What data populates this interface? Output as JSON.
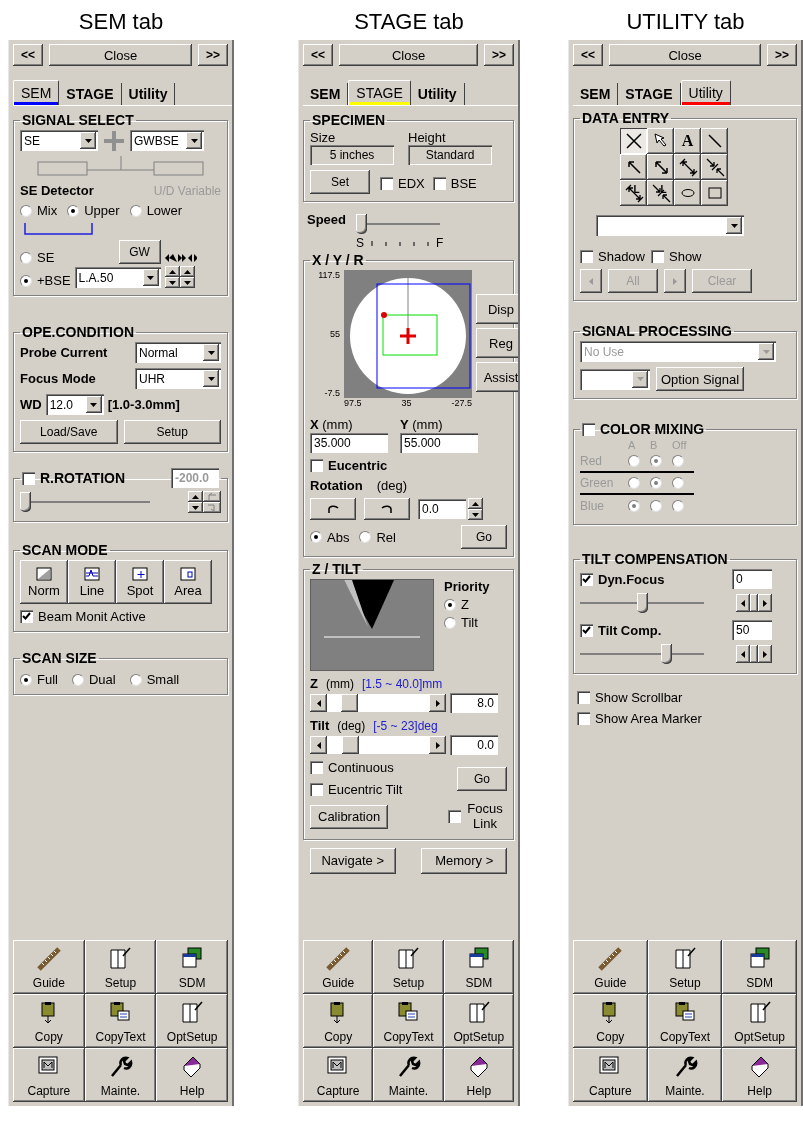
{
  "panels": [
    {
      "caption": "SEM tab",
      "color": "#0000ff",
      "nav": {
        "prev": "<<",
        "close": "Close",
        "next": ">>"
      },
      "tabs": [
        {
          "label": "SEM",
          "selected": true
        },
        {
          "label": "STAGE",
          "selected": false
        },
        {
          "label": "Utility",
          "selected": false
        }
      ],
      "sections": [
        {
          "kind": "signal_select",
          "title": "SIGNAL SELECT",
          "left": "SE",
          "right": "GWBSE",
          "detector": "SE Detector",
          "variable": {
            "label": "U/D Variable",
            "disabled": true
          },
          "detector_modes": [
            {
              "label": "Mix",
              "selected": false
            },
            {
              "label": "Upper",
              "selected": true
            },
            {
              "label": "Lower",
              "selected": false
            }
          ],
          "signals": [
            {
              "label": "SE",
              "selected": false
            },
            {
              "label": "+BSE",
              "selected": true
            }
          ],
          "gw": "GW",
          "mode": "L.A.50"
        },
        {
          "kind": "ope_condition",
          "title": "OPE.CONDITION",
          "rows": [
            {
              "label": "Probe Current",
              "value": "Normal"
            },
            {
              "label": "Focus Mode",
              "value": "UHR"
            }
          ],
          "wd": {
            "label": "WD",
            "value": "12.0",
            "range": "[1.0-3.0mm]"
          },
          "buttons": [
            "Load/Save",
            "Setup"
          ]
        },
        {
          "kind": "rotation",
          "title": "R.ROTATION",
          "checked": false,
          "value": "-200.0",
          "level": 0
        },
        {
          "kind": "scan_mode",
          "title": "SCAN MODE",
          "modes": [
            {
              "kind": "norm",
              "label": "Norm"
            },
            {
              "kind": "line",
              "label": "Line"
            },
            {
              "kind": "spot",
              "label": "Spot"
            },
            {
              "kind": "area",
              "label": "Area"
            }
          ],
          "beam": {
            "label": "Beam Monit Active",
            "checked": true
          }
        },
        {
          "kind": "scan_size",
          "title": "SCAN SIZE",
          "options": [
            {
              "label": "Full",
              "selected": true
            },
            {
              "label": "Dual",
              "selected": false
            },
            {
              "label": "Small",
              "selected": false
            }
          ]
        }
      ],
      "toolbar": [
        {
          "kind": "guide",
          "label": "Guide"
        },
        {
          "kind": "setup",
          "label": "Setup"
        },
        {
          "kind": "sdm",
          "label": "SDM"
        },
        {
          "kind": "copy",
          "label": "Copy"
        },
        {
          "kind": "copytext",
          "label": "CopyText"
        },
        {
          "kind": "setup",
          "label": "OptSetup"
        },
        {
          "kind": "capture",
          "label": "Capture"
        },
        {
          "kind": "mainte",
          "label": "Mainte."
        },
        {
          "kind": "help",
          "label": "Help"
        }
      ]
    },
    {
      "caption": "STAGE tab",
      "color": "#ffff00",
      "nav": {
        "prev": "<<",
        "close": "Close",
        "next": ">>"
      },
      "tabs": [
        {
          "label": "SEM",
          "selected": false
        },
        {
          "label": "STAGE",
          "selected": true
        },
        {
          "label": "Utility",
          "selected": false
        }
      ],
      "sections": [
        {
          "kind": "specimen",
          "title": "SPECIMEN",
          "size": {
            "label": "Size",
            "value": "5 inches"
          },
          "height": {
            "label": "Height",
            "value": "Standard"
          },
          "button": "Set",
          "checks": [
            {
              "label": "EDX",
              "checked": false
            },
            {
              "label": "BSE",
              "checked": false
            }
          ]
        },
        {
          "kind": "speed",
          "label": "Speed",
          "level": 0,
          "min": "S",
          "max": "F"
        },
        {
          "kind": "xyr",
          "title": "X / Y / R",
          "yticks": [
            "117.5",
            "55",
            "-7.5"
          ],
          "xticks": [
            "97.5",
            "35",
            "-27.5"
          ],
          "buttons": [
            "Disp",
            "Reg",
            "Assist"
          ],
          "coords": [
            {
              "label": "**X** (mm)",
              "value": "35.000"
            },
            {
              "label": "**Y** (mm)",
              "value": "55.000"
            }
          ],
          "eucentric": {
            "label": "Eucentric",
            "checked": false
          },
          "rotation": {
            "label": "Rotation",
            "unit": "(deg)",
            "value": "0.0"
          },
          "modes": [
            {
              "label": "Abs",
              "selected": true
            },
            {
              "label": "Rel",
              "selected": false
            }
          ],
          "go": "Go"
        },
        {
          "kind": "z_tilt",
          "title": "Z / TILT",
          "priority": "Priority",
          "priorities": [
            {
              "label": "Z",
              "selected": true
            },
            {
              "label": "Tilt",
              "selected": false
            }
          ],
          "axes": [
            {
              "name": "Z",
              "unit": "(mm)",
              "range": "[1.5 ~ 40.0]mm",
              "value": "8.0",
              "level": 0.17
            },
            {
              "name": "Tilt",
              "unit": "(deg)",
              "range": "[-5 ~ 23]deg",
              "value": "0.0",
              "level": 0.18
            }
          ],
          "checks": [
            {
              "label": "Continuous",
              "checked": false
            },
            {
              "label": "Eucentric Tilt",
              "checked": false
            }
          ],
          "go": "Go",
          "calibration": "Calibration",
          "focus_link": {
            "label": "Focus Link",
            "checked": false
          }
        },
        {
          "kind": "buttons",
          "buttons": [
            "Navigate >",
            "Memory >"
          ]
        }
      ],
      "toolbar": [
        {
          "kind": "guide",
          "label": "Guide"
        },
        {
          "kind": "setup",
          "label": "Setup"
        },
        {
          "kind": "sdm",
          "label": "SDM"
        },
        {
          "kind": "copy",
          "label": "Copy"
        },
        {
          "kind": "copytext",
          "label": "CopyText"
        },
        {
          "kind": "setup",
          "label": "OptSetup"
        },
        {
          "kind": "capture",
          "label": "Capture"
        },
        {
          "kind": "mainte",
          "label": "Mainte."
        },
        {
          "kind": "help",
          "label": "Help"
        }
      ]
    },
    {
      "caption": "UTILITY tab",
      "color": "#ff0000",
      "nav": {
        "prev": "<<",
        "close": "Close",
        "next": ">>"
      },
      "tabs": [
        {
          "label": "SEM",
          "selected": false
        },
        {
          "label": "STAGE",
          "selected": false
        },
        {
          "label": "Utility",
          "selected": true
        }
      ],
      "sections": [
        {
          "kind": "data_entry",
          "title": "DATA ENTRY",
          "tools": [
            {
              "kind": "cross",
              "selected": true
            },
            {
              "kind": "pointer",
              "selected": false
            },
            {
              "kind": "text",
              "label": "A",
              "selected": false
            },
            {
              "kind": "line",
              "selected": false
            },
            {
              "kind": "arrow",
              "selected": false
            },
            {
              "kind": "double_arrow",
              "selected": false
            },
            {
              "kind": "dimension",
              "selected": false
            },
            {
              "kind": "inward",
              "selected": false
            },
            {
              "kind": "dimension",
              "label": "L",
              "selected": false
            },
            {
              "kind": "inward",
              "label": "L",
              "selected": false
            },
            {
              "kind": "ellipse",
              "selected": false
            },
            {
              "kind": "rectangle",
              "selected": false
            }
          ],
          "checks": [
            {
              "label": "Shadow",
              "checked": false
            },
            {
              "label": "Show",
              "checked": false
            }
          ],
          "all": "All",
          "clear": "Clear",
          "disabled": true
        },
        {
          "kind": "signal_processing",
          "title": "SIGNAL PROCESSING",
          "source": {
            "value": "No Use",
            "disabled": true
          },
          "option": {
            "disabled": true
          },
          "button": "Option Signal"
        },
        {
          "kind": "color_mixing",
          "title": "COLOR MIXING",
          "checked": false,
          "columns": [
            "A",
            "B",
            "Off"
          ],
          "rows": [
            {
              "label": "Red",
              "options": [
                {
                  "selected": false
                },
                {
                  "selected": true
                },
                {
                  "selected": false
                }
              ]
            },
            {
              "label": "Green",
              "options": [
                {
                  "selected": false
                },
                {
                  "selected": true
                },
                {
                  "selected": false
                }
              ]
            },
            {
              "label": "Blue",
              "options": [
                {
                  "selected": true
                },
                {
                  "selected": false
                },
                {
                  "selected": false
                }
              ]
            }
          ]
        },
        {
          "kind": "tilt_compensation",
          "title": "TILT COMPENSATION",
          "items": [
            {
              "label": "Dyn.Focus",
              "checked": true,
              "value": "0",
              "level": 0.5
            },
            {
              "label": "Tilt Comp.",
              "checked": true,
              "value": "50",
              "level": 0.72
            }
          ]
        },
        {
          "kind": "checks",
          "items": [
            {
              "label": "Show Scrollbar",
              "checked": false
            },
            {
              "label": "Show Area Marker",
              "checked": false
            }
          ]
        }
      ],
      "toolbar": [
        {
          "kind": "guide",
          "label": "Guide"
        },
        {
          "kind": "setup",
          "label": "Setup"
        },
        {
          "kind": "sdm",
          "label": "SDM"
        },
        {
          "kind": "copy",
          "label": "Copy"
        },
        {
          "kind": "copytext",
          "label": "CopyText"
        },
        {
          "kind": "setup",
          "label": "OptSetup"
        },
        {
          "kind": "capture",
          "label": "Capture"
        },
        {
          "kind": "mainte",
          "label": "Mainte."
        },
        {
          "kind": "help",
          "label": "Help"
        }
      ]
    }
  ]
}
